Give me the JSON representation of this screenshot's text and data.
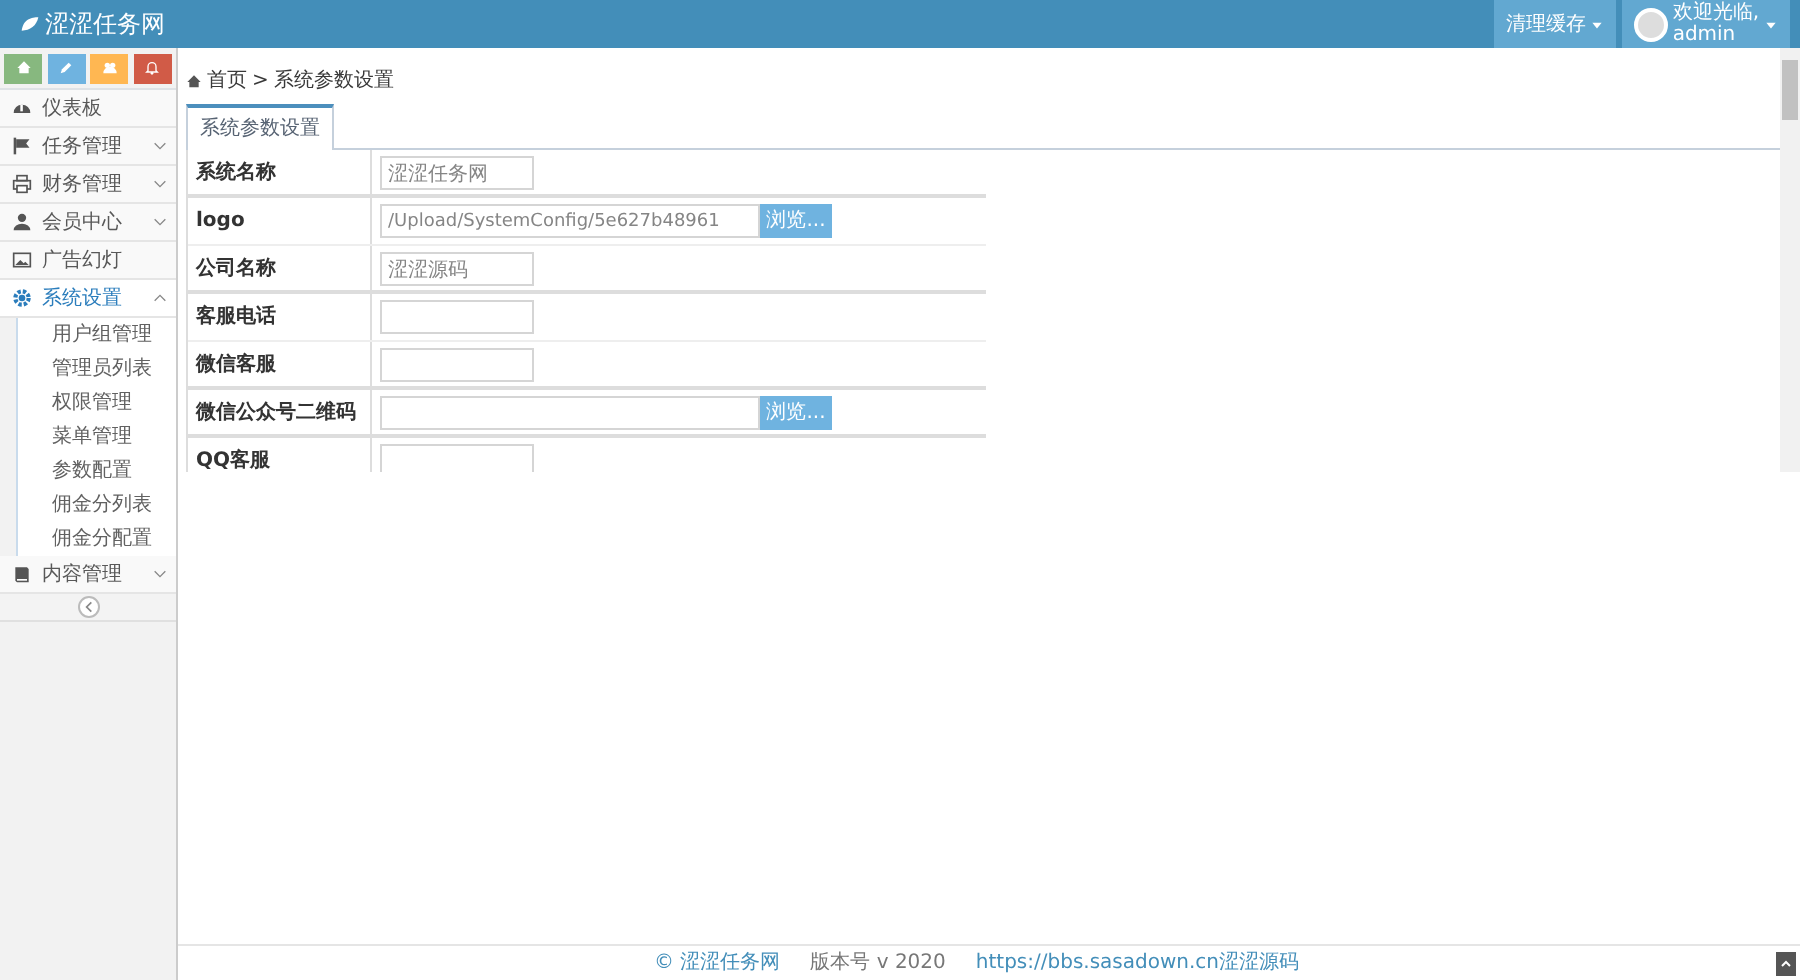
{
  "header": {
    "brand": "涩涩任务网",
    "clear_cache": "清理缓存",
    "welcome": "欢迎光临,",
    "user": "admin"
  },
  "sidebar": {
    "shortcuts": [
      {
        "color": "#87b87f"
      },
      {
        "color": "#6fb3e0"
      },
      {
        "color": "#ffb752"
      },
      {
        "color": "#d15b47"
      }
    ],
    "items": [
      {
        "label": "仪表板",
        "selected": false
      },
      {
        "label": "任务管理",
        "selected": false,
        "expanded": false
      },
      {
        "label": "财务管理",
        "selected": false,
        "expanded": false
      },
      {
        "label": "会员中心",
        "selected": false,
        "expanded": false
      },
      {
        "label": "广告幻灯",
        "selected": false
      },
      {
        "label": "系统设置",
        "selected": true,
        "expanded": true,
        "children": [
          {
            "label": "用户组管理"
          },
          {
            "label": "管理员列表"
          },
          {
            "label": "权限管理"
          },
          {
            "label": "菜单管理"
          },
          {
            "label": "参数配置"
          },
          {
            "label": "佣金分列表"
          },
          {
            "label": "佣金分配置"
          }
        ]
      },
      {
        "label": "内容管理",
        "selected": false,
        "expanded": false
      }
    ]
  },
  "breadcrumb": {
    "items": [
      "首页",
      "系统参数设置"
    ],
    "separator": ">"
  },
  "tabs": [
    {
      "label": "系统参数设置",
      "selected": true
    }
  ],
  "form": {
    "fields": [
      {
        "kind": "text",
        "label": "系统名称",
        "value": "涩涩任务网"
      },
      {
        "kind": "file",
        "label": "logo",
        "value": "/Upload/SystemConfig/5e627b48961",
        "button": "浏览..."
      },
      {
        "kind": "text",
        "label": "公司名称",
        "value": "涩涩源码"
      },
      {
        "kind": "text",
        "label": "客服电话"
      },
      {
        "kind": "text",
        "label": "微信客服"
      },
      {
        "kind": "file",
        "label": "微信公众号二维码",
        "button": "浏览..."
      },
      {
        "kind": "text",
        "label": "QQ客服"
      }
    ]
  },
  "footer": {
    "copyright": "© 涩涩任务网",
    "version": "版本号 v 2020",
    "link": "https://bbs.sasadown.cn涩涩源码"
  }
}
